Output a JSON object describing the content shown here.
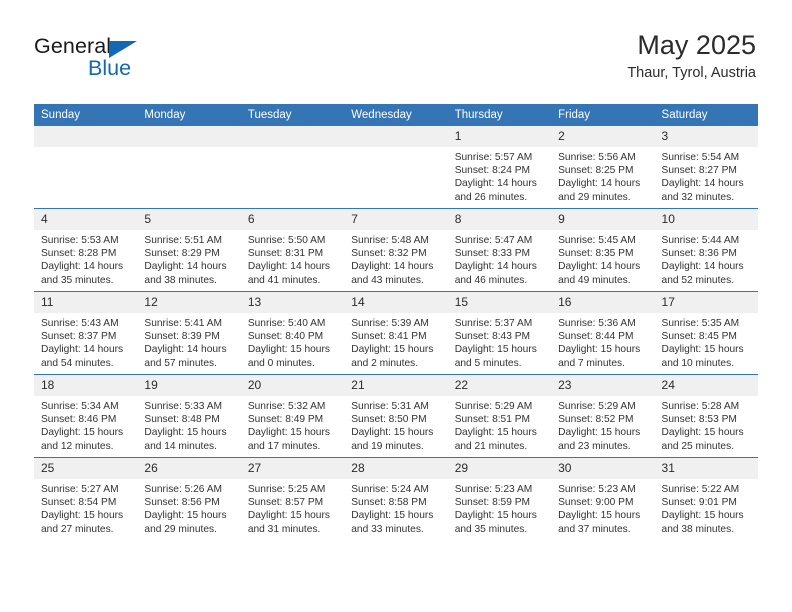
{
  "brand": {
    "name_top": "General",
    "name_bottom": "Blue",
    "triangle_color": "#1268b3",
    "text_color": "#1a1a1a"
  },
  "header": {
    "title": "May 2025",
    "subtitle": "Thaur, Tyrol, Austria"
  },
  "theme": {
    "header_bg": "#3575b5",
    "daynum_bg": "#f0f0f0",
    "rule_color": "#3575b5",
    "text_color": "#333333"
  },
  "weekdays": [
    "Sunday",
    "Monday",
    "Tuesday",
    "Wednesday",
    "Thursday",
    "Friday",
    "Saturday"
  ],
  "labels": {
    "sunrise_prefix": "Sunrise:",
    "sunset_prefix": "Sunset:",
    "daylight_prefix": "Daylight:"
  },
  "weeks": [
    [
      {
        "day": "",
        "empty": true
      },
      {
        "day": "",
        "empty": true
      },
      {
        "day": "",
        "empty": true
      },
      {
        "day": "",
        "empty": true
      },
      {
        "day": "1",
        "sunrise": "Sunrise: 5:57 AM",
        "sunset": "Sunset: 8:24 PM",
        "daylight_1": "Daylight: 14 hours",
        "daylight_2": "and 26 minutes."
      },
      {
        "day": "2",
        "sunrise": "Sunrise: 5:56 AM",
        "sunset": "Sunset: 8:25 PM",
        "daylight_1": "Daylight: 14 hours",
        "daylight_2": "and 29 minutes."
      },
      {
        "day": "3",
        "sunrise": "Sunrise: 5:54 AM",
        "sunset": "Sunset: 8:27 PM",
        "daylight_1": "Daylight: 14 hours",
        "daylight_2": "and 32 minutes."
      }
    ],
    [
      {
        "day": "4",
        "sunrise": "Sunrise: 5:53 AM",
        "sunset": "Sunset: 8:28 PM",
        "daylight_1": "Daylight: 14 hours",
        "daylight_2": "and 35 minutes."
      },
      {
        "day": "5",
        "sunrise": "Sunrise: 5:51 AM",
        "sunset": "Sunset: 8:29 PM",
        "daylight_1": "Daylight: 14 hours",
        "daylight_2": "and 38 minutes."
      },
      {
        "day": "6",
        "sunrise": "Sunrise: 5:50 AM",
        "sunset": "Sunset: 8:31 PM",
        "daylight_1": "Daylight: 14 hours",
        "daylight_2": "and 41 minutes."
      },
      {
        "day": "7",
        "sunrise": "Sunrise: 5:48 AM",
        "sunset": "Sunset: 8:32 PM",
        "daylight_1": "Daylight: 14 hours",
        "daylight_2": "and 43 minutes."
      },
      {
        "day": "8",
        "sunrise": "Sunrise: 5:47 AM",
        "sunset": "Sunset: 8:33 PM",
        "daylight_1": "Daylight: 14 hours",
        "daylight_2": "and 46 minutes."
      },
      {
        "day": "9",
        "sunrise": "Sunrise: 5:45 AM",
        "sunset": "Sunset: 8:35 PM",
        "daylight_1": "Daylight: 14 hours",
        "daylight_2": "and 49 minutes."
      },
      {
        "day": "10",
        "sunrise": "Sunrise: 5:44 AM",
        "sunset": "Sunset: 8:36 PM",
        "daylight_1": "Daylight: 14 hours",
        "daylight_2": "and 52 minutes."
      }
    ],
    [
      {
        "day": "11",
        "sunrise": "Sunrise: 5:43 AM",
        "sunset": "Sunset: 8:37 PM",
        "daylight_1": "Daylight: 14 hours",
        "daylight_2": "and 54 minutes."
      },
      {
        "day": "12",
        "sunrise": "Sunrise: 5:41 AM",
        "sunset": "Sunset: 8:39 PM",
        "daylight_1": "Daylight: 14 hours",
        "daylight_2": "and 57 minutes."
      },
      {
        "day": "13",
        "sunrise": "Sunrise: 5:40 AM",
        "sunset": "Sunset: 8:40 PM",
        "daylight_1": "Daylight: 15 hours",
        "daylight_2": "and 0 minutes."
      },
      {
        "day": "14",
        "sunrise": "Sunrise: 5:39 AM",
        "sunset": "Sunset: 8:41 PM",
        "daylight_1": "Daylight: 15 hours",
        "daylight_2": "and 2 minutes."
      },
      {
        "day": "15",
        "sunrise": "Sunrise: 5:37 AM",
        "sunset": "Sunset: 8:43 PM",
        "daylight_1": "Daylight: 15 hours",
        "daylight_2": "and 5 minutes."
      },
      {
        "day": "16",
        "sunrise": "Sunrise: 5:36 AM",
        "sunset": "Sunset: 8:44 PM",
        "daylight_1": "Daylight: 15 hours",
        "daylight_2": "and 7 minutes."
      },
      {
        "day": "17",
        "sunrise": "Sunrise: 5:35 AM",
        "sunset": "Sunset: 8:45 PM",
        "daylight_1": "Daylight: 15 hours",
        "daylight_2": "and 10 minutes."
      }
    ],
    [
      {
        "day": "18",
        "sunrise": "Sunrise: 5:34 AM",
        "sunset": "Sunset: 8:46 PM",
        "daylight_1": "Daylight: 15 hours",
        "daylight_2": "and 12 minutes."
      },
      {
        "day": "19",
        "sunrise": "Sunrise: 5:33 AM",
        "sunset": "Sunset: 8:48 PM",
        "daylight_1": "Daylight: 15 hours",
        "daylight_2": "and 14 minutes."
      },
      {
        "day": "20",
        "sunrise": "Sunrise: 5:32 AM",
        "sunset": "Sunset: 8:49 PM",
        "daylight_1": "Daylight: 15 hours",
        "daylight_2": "and 17 minutes."
      },
      {
        "day": "21",
        "sunrise": "Sunrise: 5:31 AM",
        "sunset": "Sunset: 8:50 PM",
        "daylight_1": "Daylight: 15 hours",
        "daylight_2": "and 19 minutes."
      },
      {
        "day": "22",
        "sunrise": "Sunrise: 5:29 AM",
        "sunset": "Sunset: 8:51 PM",
        "daylight_1": "Daylight: 15 hours",
        "daylight_2": "and 21 minutes."
      },
      {
        "day": "23",
        "sunrise": "Sunrise: 5:29 AM",
        "sunset": "Sunset: 8:52 PM",
        "daylight_1": "Daylight: 15 hours",
        "daylight_2": "and 23 minutes."
      },
      {
        "day": "24",
        "sunrise": "Sunrise: 5:28 AM",
        "sunset": "Sunset: 8:53 PM",
        "daylight_1": "Daylight: 15 hours",
        "daylight_2": "and 25 minutes."
      }
    ],
    [
      {
        "day": "25",
        "sunrise": "Sunrise: 5:27 AM",
        "sunset": "Sunset: 8:54 PM",
        "daylight_1": "Daylight: 15 hours",
        "daylight_2": "and 27 minutes."
      },
      {
        "day": "26",
        "sunrise": "Sunrise: 5:26 AM",
        "sunset": "Sunset: 8:56 PM",
        "daylight_1": "Daylight: 15 hours",
        "daylight_2": "and 29 minutes."
      },
      {
        "day": "27",
        "sunrise": "Sunrise: 5:25 AM",
        "sunset": "Sunset: 8:57 PM",
        "daylight_1": "Daylight: 15 hours",
        "daylight_2": "and 31 minutes."
      },
      {
        "day": "28",
        "sunrise": "Sunrise: 5:24 AM",
        "sunset": "Sunset: 8:58 PM",
        "daylight_1": "Daylight: 15 hours",
        "daylight_2": "and 33 minutes."
      },
      {
        "day": "29",
        "sunrise": "Sunrise: 5:23 AM",
        "sunset": "Sunset: 8:59 PM",
        "daylight_1": "Daylight: 15 hours",
        "daylight_2": "and 35 minutes."
      },
      {
        "day": "30",
        "sunrise": "Sunrise: 5:23 AM",
        "sunset": "Sunset: 9:00 PM",
        "daylight_1": "Daylight: 15 hours",
        "daylight_2": "and 37 minutes."
      },
      {
        "day": "31",
        "sunrise": "Sunrise: 5:22 AM",
        "sunset": "Sunset: 9:01 PM",
        "daylight_1": "Daylight: 15 hours",
        "daylight_2": "and 38 minutes."
      }
    ]
  ]
}
